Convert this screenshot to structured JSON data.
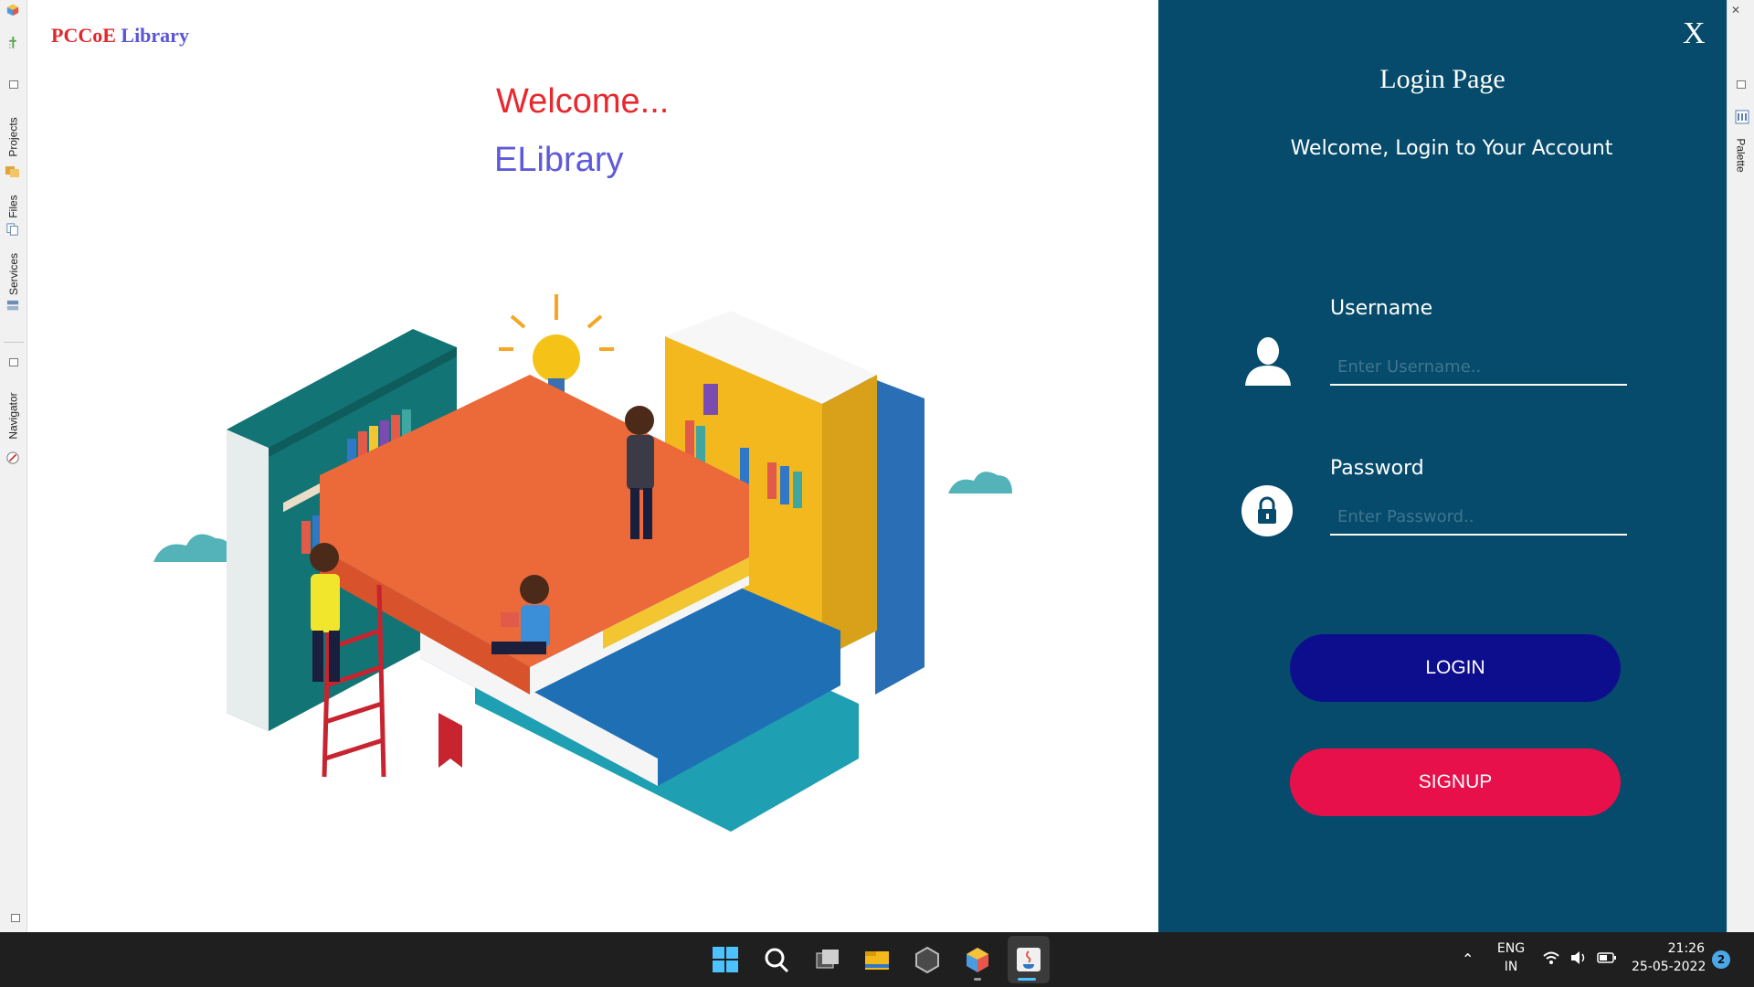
{
  "app": {
    "brand_part1": "PCCoE",
    "brand_part2": "Library"
  },
  "welcome": {
    "greeting": "Welcome...",
    "name": "ELibrary"
  },
  "ide": {
    "left_tabs": [
      "Projects",
      "Files",
      "Services",
      "Navigator"
    ],
    "right_tabs": [
      "Palette"
    ]
  },
  "login": {
    "close_label": "X",
    "title": "Login Page",
    "subtitle": "Welcome, Login to Your Account",
    "username_label": "Username",
    "username_placeholder": "Enter Username..",
    "username_value": "",
    "password_label": "Password",
    "password_placeholder": "Enter Password..",
    "password_value": "",
    "login_button": "LOGIN",
    "signup_button": "SIGNUP",
    "colors": {
      "panel": "#064b6b",
      "login": "#0d0e8e",
      "signup": "#e8104a"
    }
  },
  "taskbar": {
    "icons": [
      "windows-start-icon",
      "search-icon",
      "task-view-icon",
      "file-explorer-icon",
      "app-icon",
      "netbeans-icon",
      "java-icon"
    ],
    "language": "ENG",
    "region": "IN",
    "time": "21:26",
    "date": "25-05-2022",
    "notification_count": "2"
  }
}
